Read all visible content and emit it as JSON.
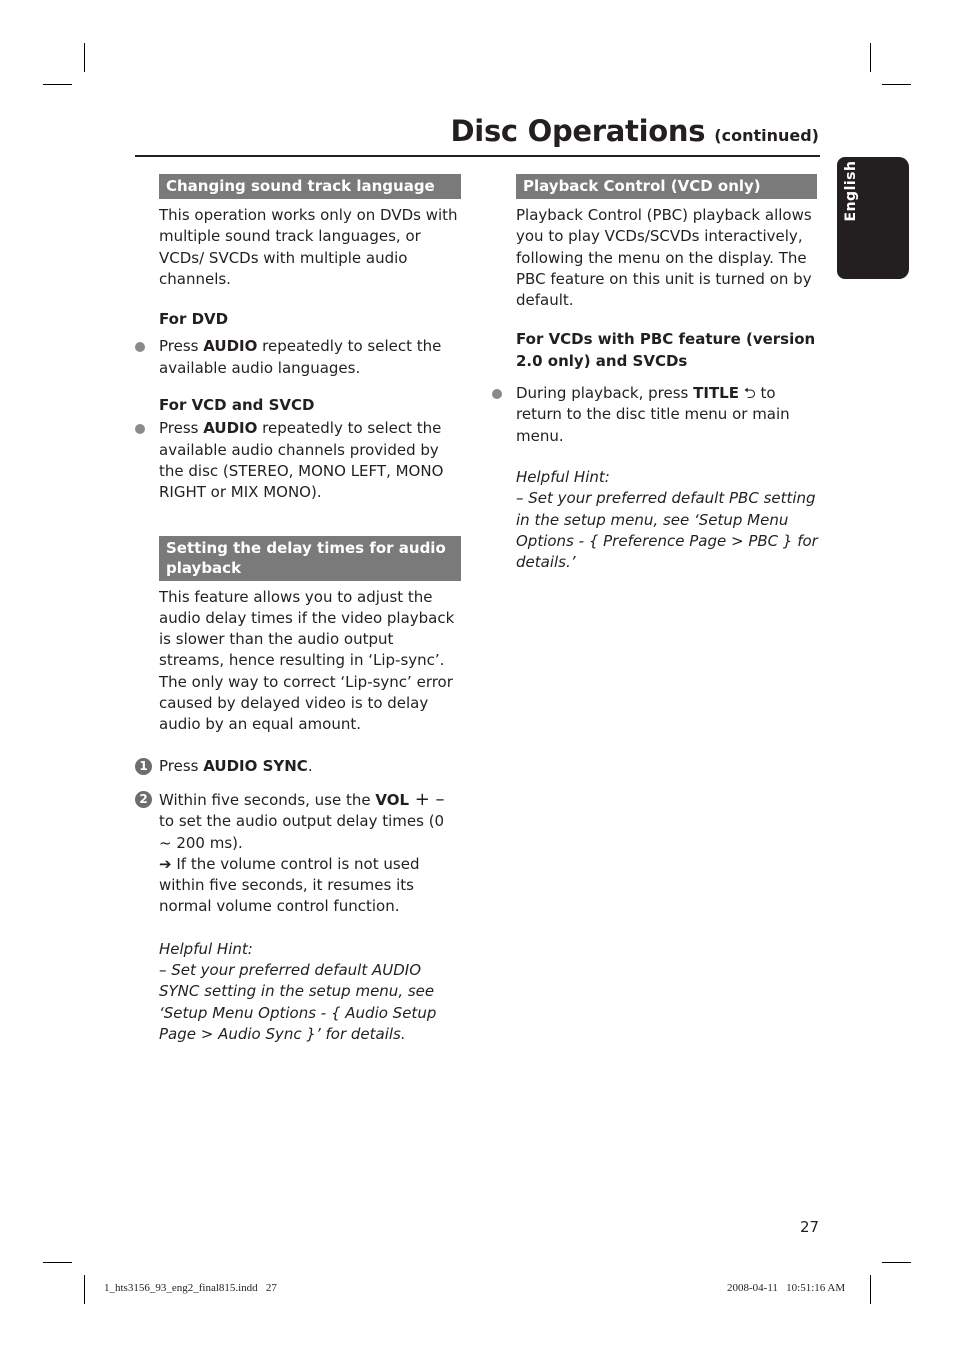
{
  "header": {
    "title": "Disc Operations",
    "subtitle": "(continued)",
    "language_tab": "English"
  },
  "left_column": {
    "section1": {
      "heading": "Changing sound track language",
      "intro": "This operation works only on DVDs with multiple sound track languages, or VCDs/ SVCDs with multiple audio channels.",
      "dvd": {
        "subheading": "For DVD",
        "bullet_pre": "Press ",
        "bullet_key": "AUDIO",
        "bullet_post": " repeatedly to select the available audio languages."
      },
      "vcd": {
        "subheading": "For VCD and SVCD",
        "bullet_pre": "Press ",
        "bullet_key": "AUDIO",
        "bullet_post": " repeatedly to select the available audio channels provided by the disc (STEREO, MONO LEFT, MONO RIGHT or MIX MONO)."
      }
    },
    "section2": {
      "heading": "Setting the delay times for audio playback",
      "intro": "This feature allows you to adjust the audio delay times if the video playback is slower than the audio output streams, hence resulting in ‘Lip-sync’. The only way to correct ‘Lip-sync’ error caused by delayed video is to delay audio by an equal amount.",
      "steps": [
        {
          "number": "1",
          "pre": "Press ",
          "key": "AUDIO SYNC",
          "post": "."
        },
        {
          "number": "2",
          "pre": "Within five seconds, use the ",
          "key": "VOL",
          "symbols": " + –",
          "post": "to set the audio output delay times (0 ~ 200 ms).",
          "arrow": "➔",
          "result": " If the volume control is not used within five seconds, it resumes its normal volume control function."
        }
      ],
      "hint_title": "Helpful Hint:",
      "hint_text": "–  Set your preferred default AUDIO SYNC setting in the setup menu, see ‘Setup Menu Options - { Audio Setup Page > Audio Sync }’ for details."
    }
  },
  "right_column": {
    "section3": {
      "heading": "Playback Control (VCD only)",
      "intro": "Playback Control (PBC) playback allows you to play VCDs/SCVDs interactively, following the menu on the display. The PBC feature on this unit is turned on by default.",
      "subheading": "For VCDs with PBC feature (version 2.0 only) and SVCDs",
      "bullet_pre": "During playback, press ",
      "bullet_key": "TITLE",
      "bullet_symbol": " ⮌",
      "bullet_post": " to return to the disc title menu or main menu.",
      "hint_title": "Helpful Hint:",
      "hint_text": "–  Set your preferred default PBC setting in the setup menu, see ‘Setup Menu Options - { Preference Page > PBC } for details.’"
    }
  },
  "footer": {
    "page_number": "27",
    "slug_file": "1_hts3156_93_eng2_final815.indd   27",
    "slug_date": "2008-04-11   10:51:16 AM"
  }
}
